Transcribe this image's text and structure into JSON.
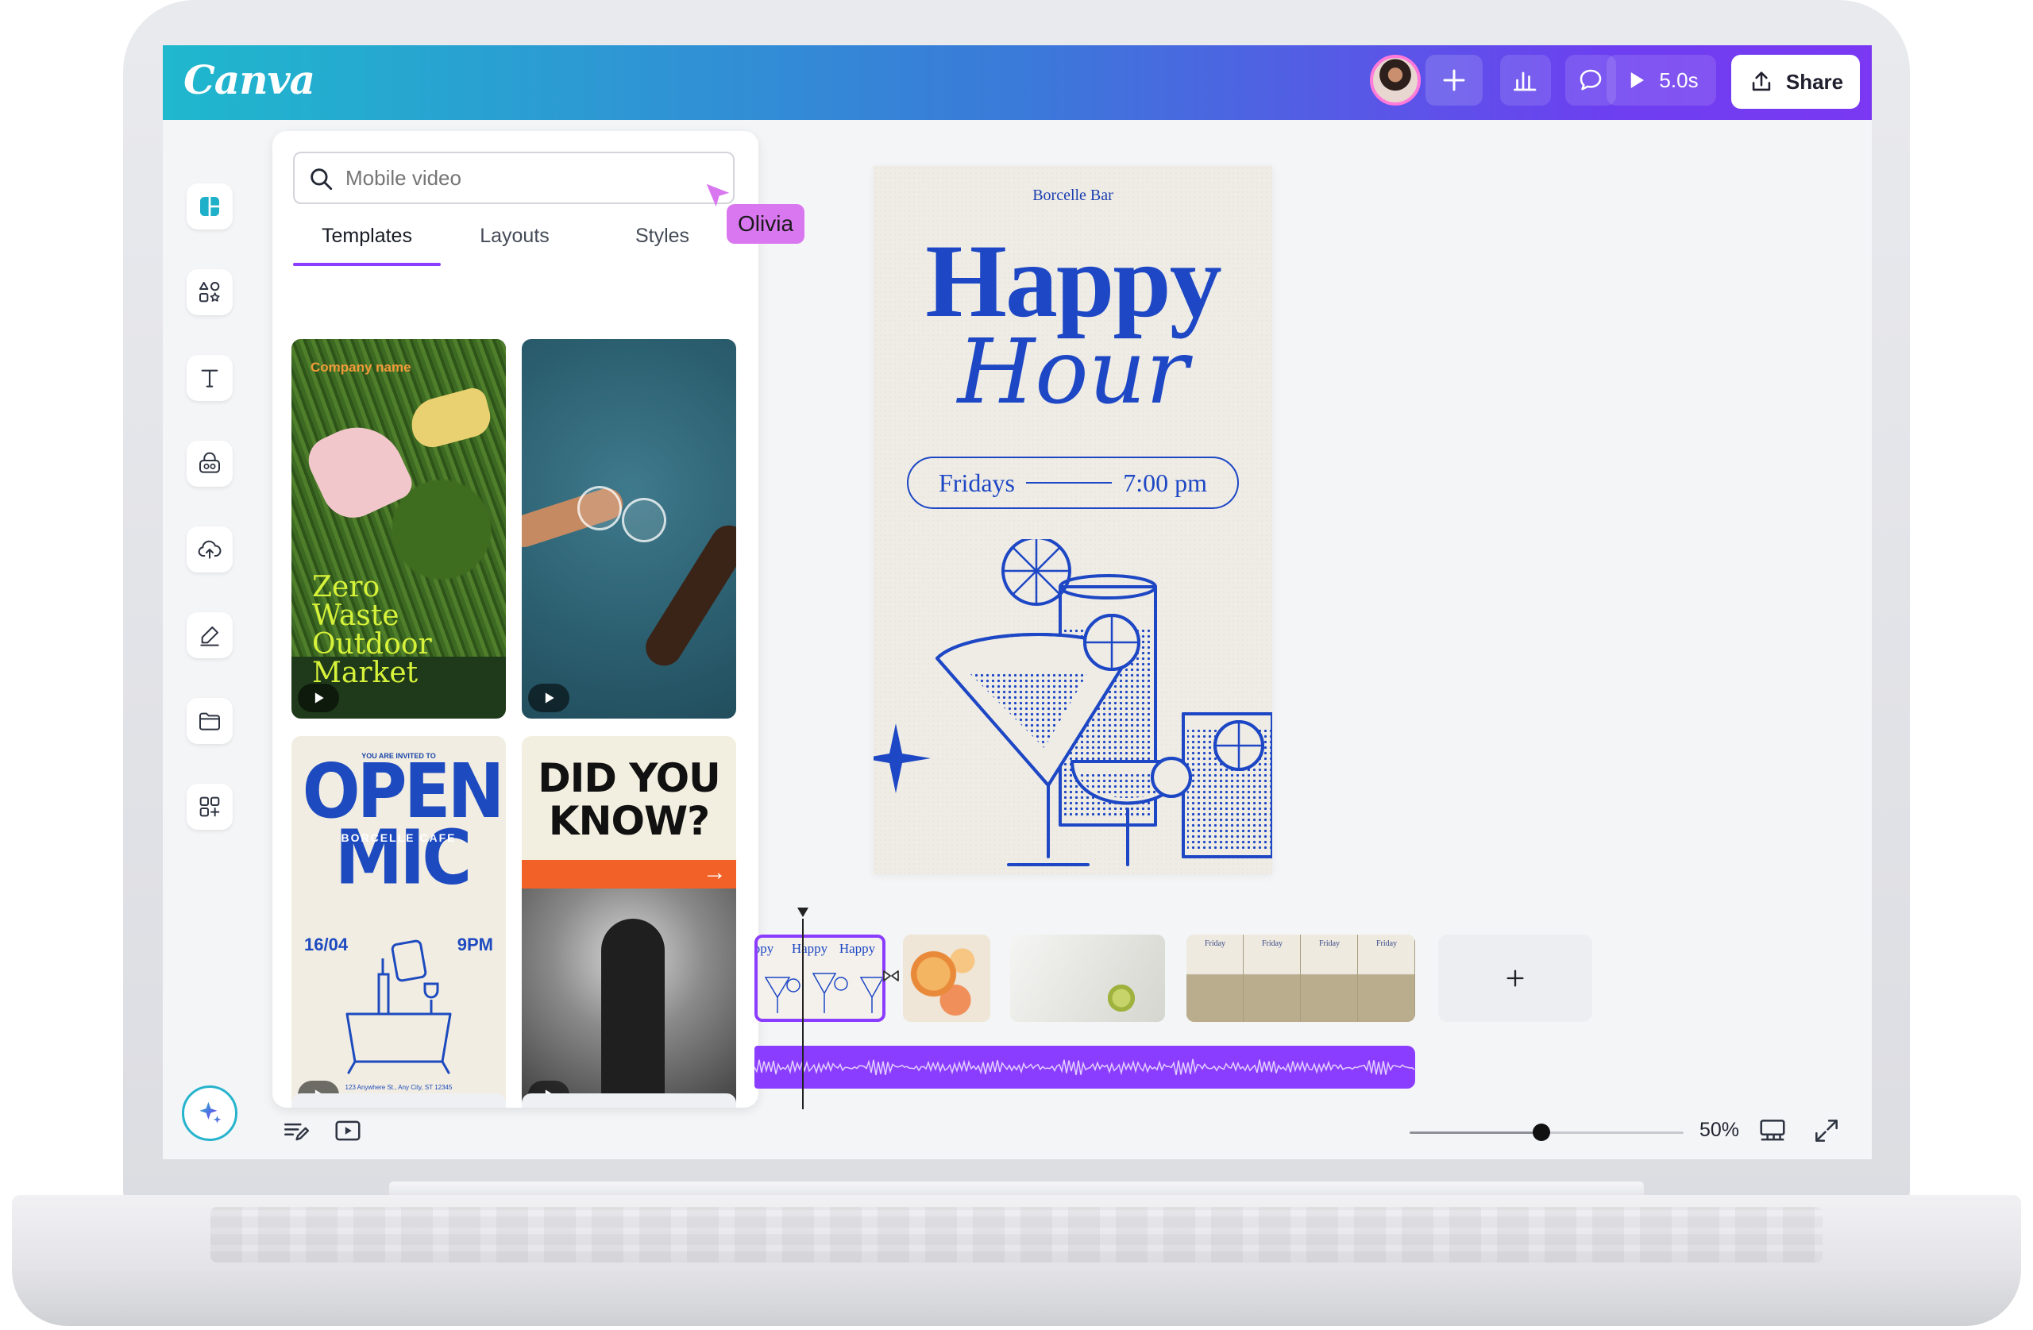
{
  "app": {
    "logo_text": "Canva",
    "brand_gradient": [
      "#1fb8cd",
      "#3a7ad9",
      "#7a38f2"
    ],
    "accent": "#8b3dff"
  },
  "header": {
    "present_duration": "5.0s",
    "share_label": "Share",
    "icons": [
      "plus-icon",
      "bar-chart-icon",
      "comment-icon",
      "play-icon",
      "share-upload-icon"
    ]
  },
  "rail": {
    "items": [
      "design-icon",
      "elements-icon",
      "text-icon",
      "brand-icon",
      "uploads-icon",
      "draw-icon",
      "projects-icon",
      "apps-icon"
    ],
    "magic_icon": "sparkle-icon"
  },
  "panel": {
    "search_placeholder": "Mobile video",
    "tabs": [
      "Templates",
      "Layouts",
      "Styles"
    ],
    "active_tab": "Templates",
    "templates": [
      {
        "brand": "Company name",
        "headline_lines": [
          "Zero",
          "Waste",
          "Outdoor",
          "Market"
        ]
      },
      {},
      {
        "top_line": "YOU ARE INVITED TO",
        "title_lines": [
          "OPEN",
          "MIC"
        ],
        "subtitle": "BORCELLE CAFE",
        "date": "16/04",
        "time": "9PM",
        "address": "123 Anywhere St., Any City, ST 12345"
      },
      {
        "headline_lines": [
          "DID YOU",
          "KNOW?"
        ]
      }
    ]
  },
  "collaborator": {
    "name": "Olivia",
    "color": "#d977f0"
  },
  "design": {
    "venue": "Borcelle Bar",
    "title_line1": "Happy",
    "title_line2": "Hour",
    "day": "Fridays",
    "time": "7:00 pm",
    "ink_color": "#1d47c4"
  },
  "timeline": {
    "clip1_labels": [
      "ppy",
      "Happy",
      "Happy"
    ],
    "clip4_labels": [
      "Friday",
      "Friday",
      "Friday",
      "Friday"
    ]
  },
  "footer": {
    "zoom_value": 0.48,
    "zoom_label": "50%"
  }
}
